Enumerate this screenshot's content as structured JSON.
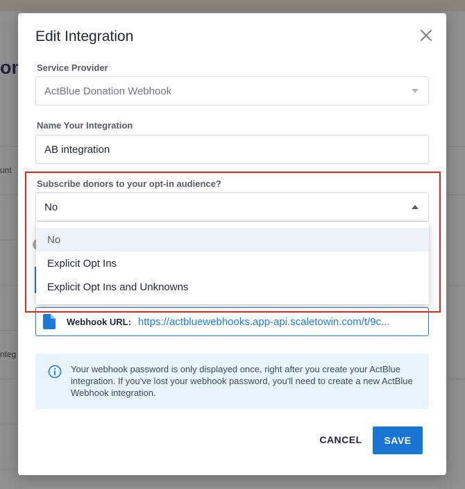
{
  "background": {
    "title_fragment": "ons",
    "fragment_1": "unt",
    "fragment_2": "nteg"
  },
  "modal": {
    "title": "Edit Integration",
    "service_provider": {
      "label": "Service Provider",
      "value": "ActBlue Donation Webhook"
    },
    "name": {
      "label": "Name Your Integration",
      "value": "AB integration"
    },
    "subscribe": {
      "label": "Subscribe donors to your opt-in audience?",
      "value": "No",
      "options": [
        "No",
        "Explicit Opt Ins",
        "Explicit Opt Ins and Unknowns"
      ]
    },
    "webhook": {
      "label": "Webhook URL:",
      "url": "https://actbluewebhooks.app-api.scaletowin.com/t/9c..."
    },
    "info": "Your webhook password is only displayed once, right after you create your ActBlue integration. If you've lost your webhook password, you'll need to create a new ActBlue Webhook integration.",
    "cancel_label": "CANCEL",
    "save_label": "SAVE"
  },
  "colors": {
    "accent": "#1976d2",
    "highlight": "#e0251b",
    "info_bg": "#e8f4fb"
  },
  "icons": {
    "close": "close-icon",
    "document": "document-icon",
    "info": "info-icon",
    "caret_down": "caret-down-icon",
    "caret_up": "caret-up-icon"
  }
}
